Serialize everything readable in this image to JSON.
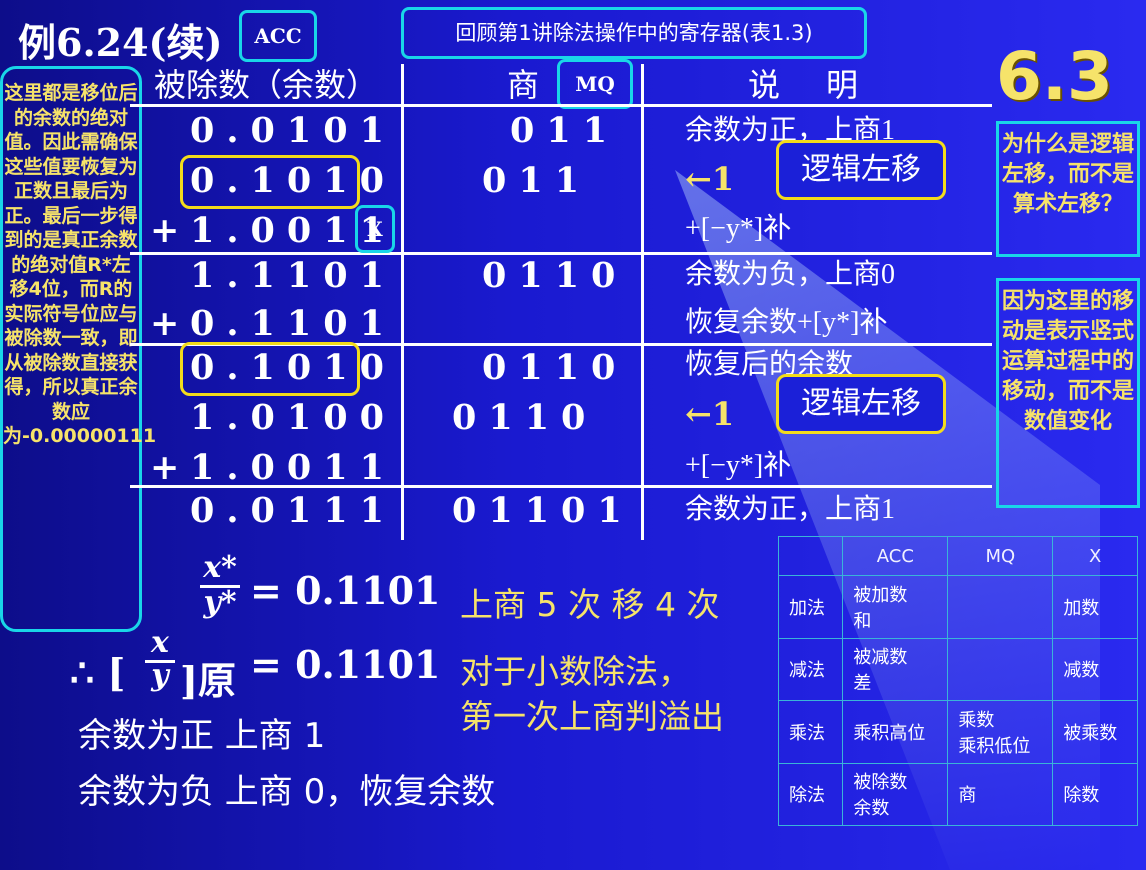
{
  "title": "例6.24(续)",
  "tags": {
    "acc": "ACC",
    "mq": "MQ",
    "x": "X"
  },
  "review_box": "回顾第1讲除法操作中的寄存器(表1.3)",
  "section_number": "6.3",
  "left_note": "这里都是移位后的余数的绝对值。因此需确保这些值要恢复为正数且最后为正。最后一步得到的是真正余数的绝对值R*左移4位，而R的实际符号位应与被除数一致，即从被除数直接获得，所以真正余数应为-0.00000111",
  "right_note_1": "为什么是逻辑左移，而不是算术左移？",
  "right_note_2": "因为这里的移动是表示竖式运算过程中的移动，而不是数值变化",
  "headers": {
    "dividend": "被除数（余数）",
    "quotient": "商",
    "explain": "说明"
  },
  "rows": [
    {
      "sign": "",
      "num": "0.0101",
      "q": "011",
      "desc": "余数为正，上商1"
    },
    {
      "sign": "",
      "num": "0.1010",
      "q": "011",
      "desc": "←1"
    },
    {
      "sign": "+",
      "num": "1.0011",
      "q": "",
      "desc": "+[−y*]补"
    },
    {
      "sign": "",
      "num": "1.1101",
      "q": "0110",
      "desc": "余数为负，上商0"
    },
    {
      "sign": "+",
      "num": "0.1101",
      "q": "",
      "desc": "恢复余数+[y*]补"
    },
    {
      "sign": "",
      "num": "0.1010",
      "q": "0110",
      "desc": "恢复后的余数"
    },
    {
      "sign": "",
      "num": "1.0100",
      "q": "0110",
      "desc": "←1"
    },
    {
      "sign": "+",
      "num": "1.0011",
      "q": "",
      "desc": "+[−y*]补"
    },
    {
      "sign": "",
      "num": "0.0111",
      "q": "01101",
      "desc": "余数为正，上商1"
    }
  ],
  "bubble_label": "逻辑左移",
  "formula1": {
    "num": "x*",
    "den": "y*",
    "result": "= 0.1101"
  },
  "formula2": {
    "prefix": "∴ [",
    "num": "x",
    "den": "y",
    "suffix": "]原",
    "result": "= 0.1101"
  },
  "summary": {
    "counts": "上商 5 次   移 4 次",
    "overflow_1": "对于小数除法，",
    "overflow_2": "第一次上商判溢出",
    "rule_pos": "余数为正   上商 1",
    "rule_neg": "余数为负   上商 0，恢复余数"
  },
  "ops_table": {
    "headers": [
      "",
      "ACC",
      "MQ",
      "X"
    ],
    "rows": [
      [
        "加法",
        "被加数\n和",
        "",
        "加数"
      ],
      [
        "减法",
        "被减数\n差",
        "",
        "减数"
      ],
      [
        "乘法",
        "乘积高位",
        "乘数\n乘积低位",
        "被乘数"
      ],
      [
        "除法",
        "被除数\n余数",
        "商",
        "除数"
      ]
    ]
  }
}
